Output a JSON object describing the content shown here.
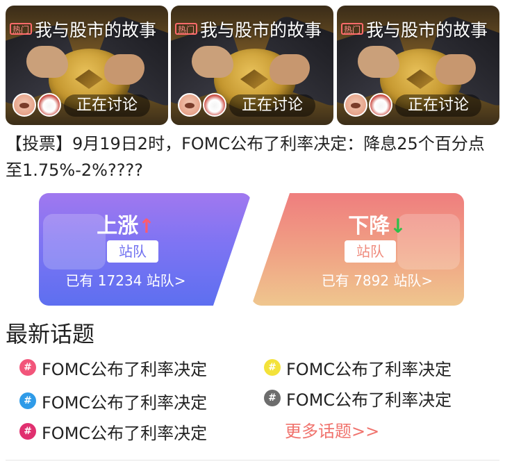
{
  "hot_cards": [
    {
      "badge": "热门",
      "title": "我与股市的故事",
      "status": "正在讨论"
    },
    {
      "badge": "热门",
      "title": "我与股市的故事",
      "status": "正在讨论"
    },
    {
      "badge": "热门",
      "title": "我与股市的故事",
      "status": "正在讨论"
    }
  ],
  "question": "【投票】9月19日2时，FOMC公布了利率决定：降息25个百分点至1.75%-2%????",
  "vote": {
    "up": {
      "label": "上涨",
      "arrow": "↑",
      "join": "站队",
      "count_text": "已有 17234 站队>"
    },
    "down": {
      "label": "下降",
      "arrow": "↓",
      "join": "站队",
      "count_text": "已有 7892 站队>"
    }
  },
  "latest_title": "最新话题",
  "topics": [
    {
      "text": "FOMC公布了利率决定",
      "color": "#f2557a",
      "icon": "#"
    },
    {
      "text": "FOMC公布了利率决定",
      "color": "#f3e23a",
      "icon": "#"
    },
    {
      "text": "FOMC公布了利率决定",
      "color": "#2f9be8",
      "icon": "#"
    },
    {
      "text": "FOMC公布了利率决定",
      "color": "#6d6d6d",
      "icon": "#"
    },
    {
      "text": "FOMC公布了利率决定",
      "color": "#e0306f",
      "icon": "#"
    }
  ],
  "more_topics": "更多话题>>"
}
